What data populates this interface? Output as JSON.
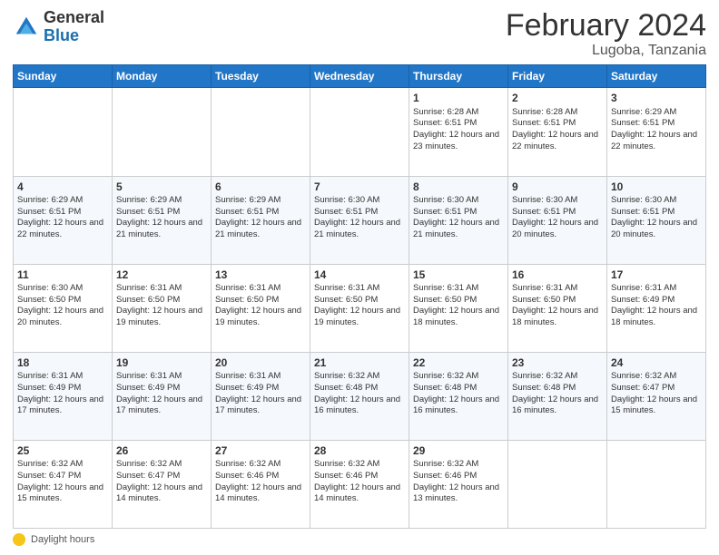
{
  "logo": {
    "general": "General",
    "blue": "Blue"
  },
  "header": {
    "month": "February 2024",
    "location": "Lugoba, Tanzania"
  },
  "weekdays": [
    "Sunday",
    "Monday",
    "Tuesday",
    "Wednesday",
    "Thursday",
    "Friday",
    "Saturday"
  ],
  "weeks": [
    [
      {
        "day": "",
        "info": ""
      },
      {
        "day": "",
        "info": ""
      },
      {
        "day": "",
        "info": ""
      },
      {
        "day": "",
        "info": ""
      },
      {
        "day": "1",
        "info": "Sunrise: 6:28 AM\nSunset: 6:51 PM\nDaylight: 12 hours and 23 minutes."
      },
      {
        "day": "2",
        "info": "Sunrise: 6:28 AM\nSunset: 6:51 PM\nDaylight: 12 hours and 22 minutes."
      },
      {
        "day": "3",
        "info": "Sunrise: 6:29 AM\nSunset: 6:51 PM\nDaylight: 12 hours and 22 minutes."
      }
    ],
    [
      {
        "day": "4",
        "info": "Sunrise: 6:29 AM\nSunset: 6:51 PM\nDaylight: 12 hours and 22 minutes."
      },
      {
        "day": "5",
        "info": "Sunrise: 6:29 AM\nSunset: 6:51 PM\nDaylight: 12 hours and 21 minutes."
      },
      {
        "day": "6",
        "info": "Sunrise: 6:29 AM\nSunset: 6:51 PM\nDaylight: 12 hours and 21 minutes."
      },
      {
        "day": "7",
        "info": "Sunrise: 6:30 AM\nSunset: 6:51 PM\nDaylight: 12 hours and 21 minutes."
      },
      {
        "day": "8",
        "info": "Sunrise: 6:30 AM\nSunset: 6:51 PM\nDaylight: 12 hours and 21 minutes."
      },
      {
        "day": "9",
        "info": "Sunrise: 6:30 AM\nSunset: 6:51 PM\nDaylight: 12 hours and 20 minutes."
      },
      {
        "day": "10",
        "info": "Sunrise: 6:30 AM\nSunset: 6:51 PM\nDaylight: 12 hours and 20 minutes."
      }
    ],
    [
      {
        "day": "11",
        "info": "Sunrise: 6:30 AM\nSunset: 6:50 PM\nDaylight: 12 hours and 20 minutes."
      },
      {
        "day": "12",
        "info": "Sunrise: 6:31 AM\nSunset: 6:50 PM\nDaylight: 12 hours and 19 minutes."
      },
      {
        "day": "13",
        "info": "Sunrise: 6:31 AM\nSunset: 6:50 PM\nDaylight: 12 hours and 19 minutes."
      },
      {
        "day": "14",
        "info": "Sunrise: 6:31 AM\nSunset: 6:50 PM\nDaylight: 12 hours and 19 minutes."
      },
      {
        "day": "15",
        "info": "Sunrise: 6:31 AM\nSunset: 6:50 PM\nDaylight: 12 hours and 18 minutes."
      },
      {
        "day": "16",
        "info": "Sunrise: 6:31 AM\nSunset: 6:50 PM\nDaylight: 12 hours and 18 minutes."
      },
      {
        "day": "17",
        "info": "Sunrise: 6:31 AM\nSunset: 6:49 PM\nDaylight: 12 hours and 18 minutes."
      }
    ],
    [
      {
        "day": "18",
        "info": "Sunrise: 6:31 AM\nSunset: 6:49 PM\nDaylight: 12 hours and 17 minutes."
      },
      {
        "day": "19",
        "info": "Sunrise: 6:31 AM\nSunset: 6:49 PM\nDaylight: 12 hours and 17 minutes."
      },
      {
        "day": "20",
        "info": "Sunrise: 6:31 AM\nSunset: 6:49 PM\nDaylight: 12 hours and 17 minutes."
      },
      {
        "day": "21",
        "info": "Sunrise: 6:32 AM\nSunset: 6:48 PM\nDaylight: 12 hours and 16 minutes."
      },
      {
        "day": "22",
        "info": "Sunrise: 6:32 AM\nSunset: 6:48 PM\nDaylight: 12 hours and 16 minutes."
      },
      {
        "day": "23",
        "info": "Sunrise: 6:32 AM\nSunset: 6:48 PM\nDaylight: 12 hours and 16 minutes."
      },
      {
        "day": "24",
        "info": "Sunrise: 6:32 AM\nSunset: 6:47 PM\nDaylight: 12 hours and 15 minutes."
      }
    ],
    [
      {
        "day": "25",
        "info": "Sunrise: 6:32 AM\nSunset: 6:47 PM\nDaylight: 12 hours and 15 minutes."
      },
      {
        "day": "26",
        "info": "Sunrise: 6:32 AM\nSunset: 6:47 PM\nDaylight: 12 hours and 14 minutes."
      },
      {
        "day": "27",
        "info": "Sunrise: 6:32 AM\nSunset: 6:46 PM\nDaylight: 12 hours and 14 minutes."
      },
      {
        "day": "28",
        "info": "Sunrise: 6:32 AM\nSunset: 6:46 PM\nDaylight: 12 hours and 14 minutes."
      },
      {
        "day": "29",
        "info": "Sunrise: 6:32 AM\nSunset: 6:46 PM\nDaylight: 12 hours and 13 minutes."
      },
      {
        "day": "",
        "info": ""
      },
      {
        "day": "",
        "info": ""
      }
    ]
  ],
  "legend": {
    "daylight_label": "Daylight hours"
  }
}
